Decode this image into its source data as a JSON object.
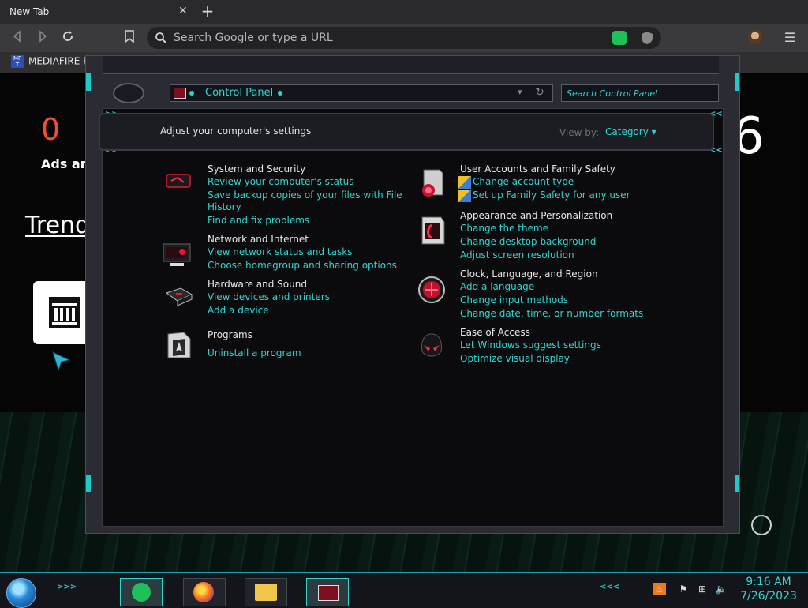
{
  "browser": {
    "tab_title": "New Tab",
    "tab_close": "✕",
    "new_tab": "+",
    "omnibox_placeholder": "Search Google or type a URL",
    "bookmark_label": "MEDIAFIRE RO",
    "bookmark_icon_text": "MF T"
  },
  "page": {
    "stat_value": "0",
    "stat_label": "Ads and",
    "trending_heading": "Trend",
    "right_number": "6"
  },
  "control_panel": {
    "breadcrumb": "Control Panel",
    "search_placeholder": "Search Control Panel",
    "header_text": "Adjust your computer's settings",
    "view_by_label": "View by:",
    "view_by_value": "Category ▾",
    "categories": [
      {
        "title": "System and Security",
        "icon": "system-security-icon",
        "links": [
          "Review your computer's status",
          "Save backup copies of your files with File",
          "History",
          "Find and fix problems"
        ]
      },
      {
        "title": "Network and Internet",
        "icon": "network-internet-icon",
        "links": [
          "View network status and tasks",
          "Choose homegroup and sharing options"
        ]
      },
      {
        "title": "Hardware and Sound",
        "icon": "hardware-sound-icon",
        "links": [
          "View devices and printers",
          "Add a device"
        ]
      },
      {
        "title": "Programs",
        "icon": "programs-icon",
        "links": [
          "Uninstall a program"
        ]
      },
      {
        "title": "User Accounts and Family Safety",
        "icon": "user-accounts-icon",
        "links": [
          "Change account type",
          "Set up Family Safety for any user"
        ]
      },
      {
        "title": "Appearance and Personalization",
        "icon": "appearance-icon",
        "links": [
          "Change the theme",
          "Change desktop background",
          "Adjust screen resolution"
        ]
      },
      {
        "title": "Clock, Language, and Region",
        "icon": "clock-language-icon",
        "links": [
          "Add a language",
          "Change input methods",
          "Change date, time, or number formats"
        ]
      },
      {
        "title": "Ease of Access",
        "icon": "ease-of-access-icon",
        "links": [
          "Let Windows suggest settings",
          "Optimize visual display"
        ]
      }
    ]
  },
  "taskbar": {
    "time": "9:16 AM",
    "date": "7/26/2023"
  },
  "colors": {
    "accent": "#2fd6d0",
    "window_bg": "#0b0b0d",
    "stat_red": "#f0502e"
  }
}
